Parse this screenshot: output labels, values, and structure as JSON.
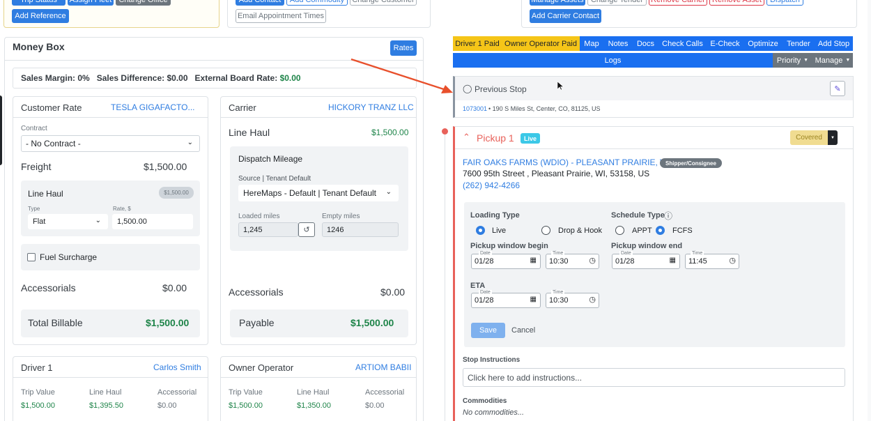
{
  "top_left": {
    "trip_status": "Trip Status",
    "assign_fleet": "Assign Fleet",
    "change_office": "Change Office",
    "add_reference": "Add Reference"
  },
  "top_mid": {
    "add_contact": "Add Contact",
    "add_commodity": "Add Commodity",
    "change_customer": "Change Customer",
    "email_appt": "Email Appointment Times"
  },
  "top_right": {
    "manage_assets": "Manage Assets",
    "change_tender": "Change Tender",
    "remove_carrier": "Remove Carrier",
    "remove_asset": "Remove Asset",
    "dispatch": "Dispatch",
    "add_carrier_contact": "Add Carrier Contact"
  },
  "money_box": {
    "title": "Money Box",
    "rates": "Rates",
    "summary": {
      "sm_label": "Sales Margin:",
      "sm_value": "0%",
      "sd_label": "Sales Difference:",
      "sd_value": "$0.00",
      "ebr_label": "External Board Rate:",
      "ebr_value": "$0.00"
    },
    "customer": {
      "title": "Customer Rate",
      "name": "TESLA GIGAFACTO...",
      "contract_label": "Contract",
      "contract_value": "- No Contract -",
      "freight_label": "Freight",
      "freight_value": "$1,500.00",
      "line_haul": "Line Haul",
      "line_haul_badge": "$1,500.00",
      "type_label": "Type",
      "type_value": "Flat",
      "rate_label": "Rate, $",
      "rate_value": "1,500.00",
      "fuel": "Fuel Surcharge",
      "acc_label": "Accessorials",
      "acc_value": "$0.00",
      "total_label": "Total Billable",
      "total_value": "$1,500.00"
    },
    "carrier": {
      "title": "Carrier",
      "name": "HICKORY TRANZ LLC",
      "lh_label": "Line Haul",
      "lh_value": "$1,500.00",
      "dm_title": "Dispatch Mileage",
      "source_label": "Source | Tenant Default",
      "source_value": "HereMaps - Default | Tenant Default",
      "loaded_label": "Loaded miles",
      "loaded_value": "1,245",
      "empty_label": "Empty miles",
      "empty_value": "1246",
      "acc_label": "Accessorials",
      "acc_value": "$0.00",
      "pay_label": "Payable",
      "pay_value": "$1,500.00"
    },
    "driver": {
      "title": "Driver 1",
      "name": "Carlos Smith",
      "h1": "Trip Value",
      "h2": "Line Haul",
      "h3": "Accessorial",
      "v1": "$1,500.00",
      "v2": "$1,395.50",
      "v3": "$0.00"
    },
    "owner": {
      "title": "Owner Operator",
      "name": "ARTIOM BABII",
      "h1": "Trip Value",
      "h2": "Line Haul",
      "h3": "Accessorial",
      "v1": "$1,500.00",
      "v2": "$1,350.00",
      "v3": "$0.00"
    }
  },
  "tabs": [
    "Driver 1 Paid",
    "Owner Operator Paid",
    "Map",
    "Notes",
    "Docs",
    "Check Calls",
    "E-Check",
    "Optimize",
    "Tender",
    "Add Stop"
  ],
  "logs_bar": {
    "logs": "Logs",
    "priority": "Priority",
    "manage": "Manage"
  },
  "prev_stop": {
    "title": "Previous Stop",
    "id": "1073001",
    "address": "• 190 S Miles St, Center, CO, 81125, US"
  },
  "pickup": {
    "title": "Pickup 1",
    "badge": "Live",
    "status": "Covered",
    "company": "FAIR OAKS FARMS (WDIO) - PLEASANT PRAIRIE, WI",
    "role": "Shipper/Consignee",
    "address": "7600 95th Street , Pleasant Prairie, WI, 53158, US",
    "phone": "(262) 942-4266",
    "loading_type": "Loading Type",
    "live": "Live",
    "drop_hook": "Drop & Hook",
    "schedule_type": "Schedule Type",
    "appt": "APPT",
    "fcfs": "FCFS",
    "pw_begin": "Pickup window begin",
    "pw_end": "Pickup window end",
    "date_label": "Date",
    "time_label": "Time",
    "begin_date": "01/28",
    "begin_time": "10:30",
    "end_date": "01/28",
    "end_time": "11:45",
    "eta": "ETA",
    "eta_date": "01/28",
    "eta_time": "10:30",
    "save": "Save",
    "cancel": "Cancel",
    "instr_label": "Stop Instructions",
    "instr_placeholder": "Click here to add instructions...",
    "commodities": "Commodities",
    "no_commodities": "No commodities..."
  },
  "colors": {
    "accent": "#2f7de1",
    "yellow": "#f5c518",
    "green": "#1e8449",
    "red": "#e8615a"
  }
}
